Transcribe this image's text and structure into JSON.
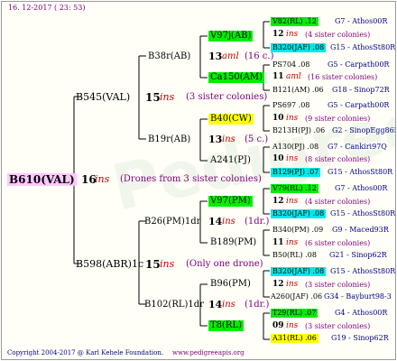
{
  "header": {
    "date": "16. 12-2017 ( 23: 53)"
  },
  "footer": {
    "copyright": "Copyright 2004-2017 @ Karl Kehele Foundation.",
    "site": "www.pedigreeapis.org"
  },
  "watermark": "Pedigree",
  "colors": {
    "pink": "#ffc8ff",
    "green": "#00ee00",
    "cyan": "#00e8e8",
    "yellow": "#ffff00",
    "blue": "#0000cc",
    "navy": "#000080",
    "purple": "#800080",
    "red": "#cc0000",
    "line": "#000000"
  },
  "root": {
    "label": "B610(VAL)",
    "year": "16",
    "ins": "ins",
    "note": "(Drones from 3 sister colonies)"
  },
  "gen2": {
    "top": {
      "label": "B545(VAL)",
      "year": "15",
      "ins": "ins",
      "note": "(3 sister colonies)"
    },
    "bottom": {
      "label": "B598(ABR)1c",
      "year": "15",
      "ins": "ins",
      "note": "(Only one drone)"
    }
  },
  "gen3": {
    "a": {
      "label": "B38r(AB)",
      "year": "13",
      "ins": "aml",
      "note": "(16 c.)"
    },
    "b": {
      "label": "B19r(AB)",
      "year": "13",
      "ins": "ins",
      "note": "(5 c.)"
    },
    "c": {
      "label": "B26(PM)1dr",
      "year": "14",
      "ins": "ins",
      "note": "(1dr.)"
    },
    "d": {
      "label": "B102(RL)1dr",
      "year": "14",
      "ins": "ins",
      "note": "(1dr.)"
    }
  },
  "gen4": {
    "a1": {
      "label": "V97j(AB)"
    },
    "a2": {
      "label": "Ca150(AM)"
    },
    "b1": {
      "label": "B40(CW)"
    },
    "b2": {
      "label": "A241(PJ)"
    },
    "c1": {
      "label": "V97(PM)"
    },
    "c2": {
      "label": "B189(PM)"
    },
    "d1": {
      "label": "B96(PM)"
    },
    "d2": {
      "label": "T8(RL)"
    }
  },
  "gen5": [
    {
      "label": "V82(RL) .12",
      "ref": "G7 - Athos00R"
    },
    {
      "year": "12",
      "ins": "ins",
      "note": "(4 sister colonies)"
    },
    {
      "label": "B320(JAF) .08",
      "ref": "G15 - AthosSt80R"
    },
    {
      "label": "PS704 .08",
      "ref": "G5 - Carpath00R"
    },
    {
      "year": "11",
      "ins": "aml",
      "note": "(16 sister colonies)"
    },
    {
      "label": "B121(AM) .06",
      "ref": "G18 - Sinop72R"
    },
    {
      "label": "PS697 .08",
      "ref": "G5 - Carpath00R"
    },
    {
      "year": "10",
      "ins": "ins",
      "note": "(9 sister colonies)"
    },
    {
      "label": "B213H(PJ) .06",
      "ref": "G2 - SinopEgg86R"
    },
    {
      "label": "A130(PJ) .08",
      "ref": "G7 - Cankiri97Q"
    },
    {
      "year": "10",
      "ins": "ins",
      "note": "(8 sister colonies)"
    },
    {
      "label": "B129(PJ) .07",
      "ref": "G15 - AthosSt80R"
    },
    {
      "label": "V79(RL) .12",
      "ref": "G7 - Athos00R"
    },
    {
      "year": "12",
      "ins": "ins",
      "note": "(4 sister colonies)"
    },
    {
      "label": "B320(JAF) .08",
      "ref": "G15 - AthosSt80R"
    },
    {
      "label": "B340(PM) .09",
      "ref": "G9 - Maced93R"
    },
    {
      "year": "11",
      "ins": "ins",
      "note": "(6 sister colonies)"
    },
    {
      "label": "B50(RL) .08",
      "ref": "G21 - Sinop62R"
    },
    {
      "label": "B320(JAF) .08",
      "ref": "G15 - AthosSt80R"
    },
    {
      "year": "12",
      "ins": "ins",
      "note": "(3 sister colonies)"
    },
    {
      "label": "A260(JAF) .06",
      "ref": "G34 - Bayburt98-3"
    },
    {
      "label": "T29(RL) .07",
      "ref": "G4 - Athos00R"
    },
    {
      "year": "09",
      "ins": "ins",
      "note": "(3 sister colonies)"
    },
    {
      "label": "A31(RL) .06",
      "ref": "G19 - Sinop62R"
    }
  ]
}
